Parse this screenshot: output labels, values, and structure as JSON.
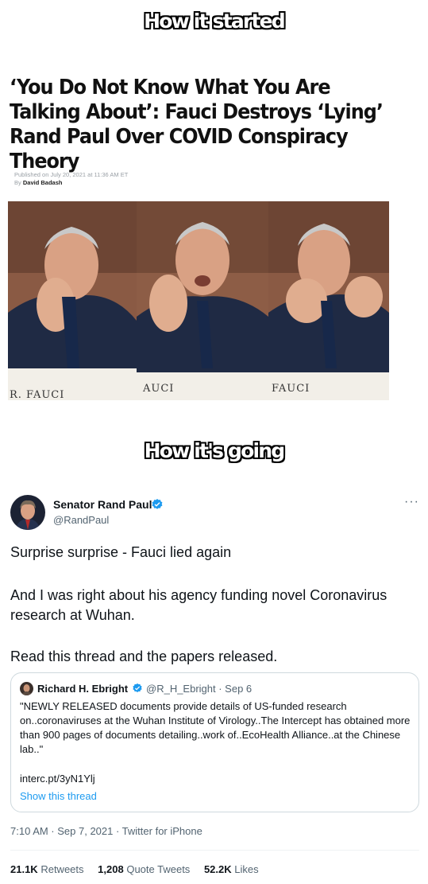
{
  "meme": {
    "caption_top": "How it started",
    "caption_mid": "How it's going"
  },
  "article": {
    "headline": "‘You Do Not Know What You Are Talking About’: Fauci Destroys ‘Lying’ Rand Paul Over COVID Conspiracy Theory",
    "published": "Published on July 20, 2021 at 11:36 AM ET",
    "by_prefix": "By",
    "author": "David Badash",
    "nameplates": [
      "R. FAUCI",
      "AUCI",
      "FAUCI"
    ]
  },
  "tweet": {
    "name": "Senator Rand Paul",
    "handle": "@RandPaul",
    "more_icon": "more-horizontal-icon",
    "text_1": "Surprise surprise - Fauci lied again",
    "text_2": "And I was right about his agency funding novel Coronavirus research at Wuhan.",
    "text_3": "Read this thread and the papers released.",
    "quote": {
      "name": "Richard H. Ebright",
      "meta": "@R_H_Ebright · Sep 6",
      "text": "\"NEWLY RELEASED documents provide details of US-funded research on..coronaviruses at the Wuhan Institute of Virology..The Intercept has obtained more than 900 pages of documents detailing..work of..EcoHealth Alliance..at the Chinese lab..\"",
      "link": "interc.pt/3yN1Ylj",
      "show_thread": "Show this thread"
    },
    "timestamp": "7:10 AM · Sep 7, 2021 · Twitter for iPhone",
    "stats": {
      "retweets_count": "21.1K",
      "retweets_label": "Retweets",
      "quotes_count": "1,208",
      "quotes_label": "Quote Tweets",
      "likes_count": "52.2K",
      "likes_label": "Likes"
    },
    "colors": {
      "accent": "#1d9bf0",
      "secondary_text": "#536471",
      "border": "#cfd9de"
    }
  }
}
